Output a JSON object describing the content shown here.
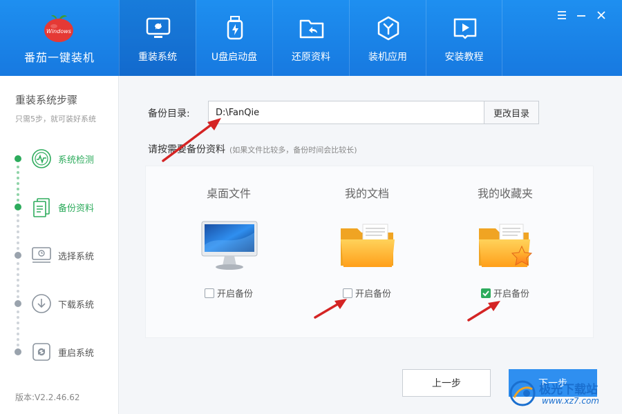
{
  "app": {
    "name": "番茄一键装机",
    "logo_text": "Windows"
  },
  "nav": [
    {
      "label": "重装系统",
      "icon": "monitor-refresh-icon"
    },
    {
      "label": "U盘启动盘",
      "icon": "usb-drive-icon"
    },
    {
      "label": "还原资料",
      "icon": "restore-folder-icon"
    },
    {
      "label": "装机应用",
      "icon": "app-hexagon-icon"
    },
    {
      "label": "安装教程",
      "icon": "video-book-icon"
    }
  ],
  "sidebar": {
    "title": "重装系统步骤",
    "subtitle": "只需5步，就可装好系统",
    "steps": [
      {
        "label": "系统检测",
        "status": "done"
      },
      {
        "label": "备份资料",
        "status": "done"
      },
      {
        "label": "选择系统",
        "status": "pending"
      },
      {
        "label": "下载系统",
        "status": "pending"
      },
      {
        "label": "重启系统",
        "status": "pending"
      }
    ],
    "version": "版本:V2.2.46.62"
  },
  "main": {
    "dir_label": "备份目录:",
    "dir_value": "D:\\FanQie",
    "dir_button": "更改目录",
    "prompt": "请按需要备份资料",
    "prompt_note": "(如果文件比较多，备份时间会比较长)",
    "cards": [
      {
        "title": "桌面文件",
        "check_label": "开启备份",
        "checked": false,
        "icon": "desktop-monitor-icon"
      },
      {
        "title": "我的文档",
        "check_label": "开启备份",
        "checked": false,
        "icon": "folder-documents-icon"
      },
      {
        "title": "我的收藏夹",
        "check_label": "开启备份",
        "checked": true,
        "icon": "folder-favorites-icon"
      }
    ],
    "prev_button": "上一步",
    "next_button": "下一步"
  },
  "watermark": {
    "text": "极光下载站",
    "url": "www.xz7.com"
  },
  "colors": {
    "header": "#1e8ff0",
    "active_green": "#2dab5c",
    "primary_button": "#2f8ff0",
    "arrow_red": "#d42424"
  }
}
